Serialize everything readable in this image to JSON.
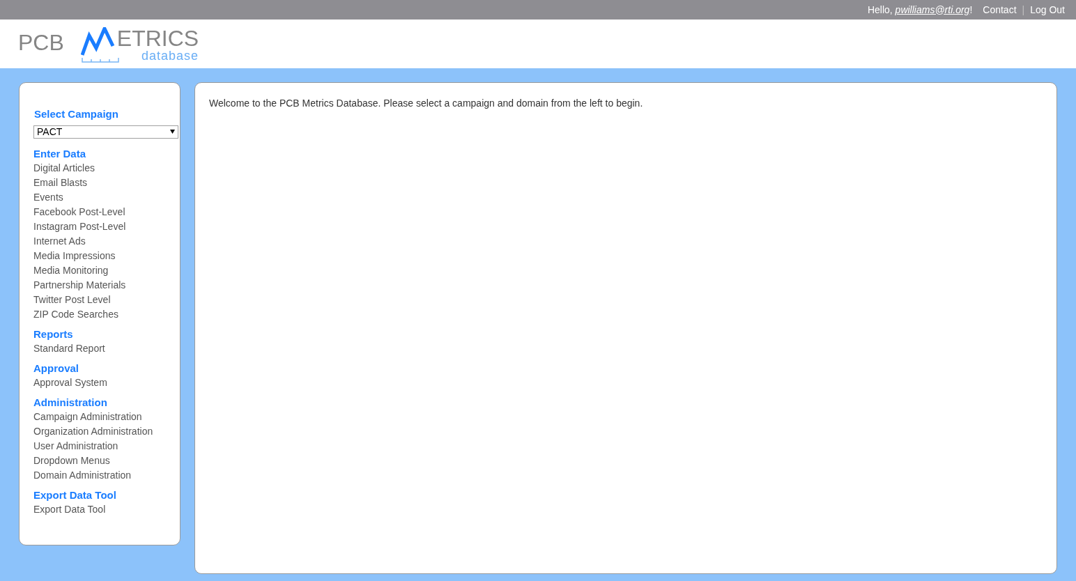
{
  "top_bar": {
    "greeting": "Hello, ",
    "user": "pwilliams@rti.org",
    "greeting_end": "!",
    "links": [
      "Contact",
      "Log Out"
    ],
    "separator": "|"
  },
  "logo": {
    "left": "PCB",
    "word": "ETRICS",
    "sub": "database"
  },
  "sidebar": {
    "campaign_label": "Select Campaign",
    "campaign_value": "PACT",
    "sections": [
      {
        "title": "Enter Data",
        "items": [
          "Digital Articles",
          "Email Blasts",
          "Events",
          "Facebook Post-Level",
          "Instagram Post-Level",
          "Internet Ads",
          "Media Impressions",
          "Media Monitoring",
          "Partnership Materials",
          "Twitter Post Level",
          "ZIP Code Searches"
        ]
      },
      {
        "title": "Reports",
        "items": [
          "Standard Report"
        ]
      },
      {
        "title": "Approval",
        "items": [
          "Approval System"
        ]
      },
      {
        "title": "Administration",
        "items": [
          "Campaign Administration",
          "Organization Administration",
          "User Administration",
          "Dropdown Menus",
          "Domain Administration"
        ]
      },
      {
        "title": "Export Data Tool",
        "items": [
          "Export Data Tool"
        ]
      }
    ]
  },
  "main": {
    "welcome": "Welcome to the PCB Metrics Database. Please select a campaign and domain from the left to begin."
  }
}
